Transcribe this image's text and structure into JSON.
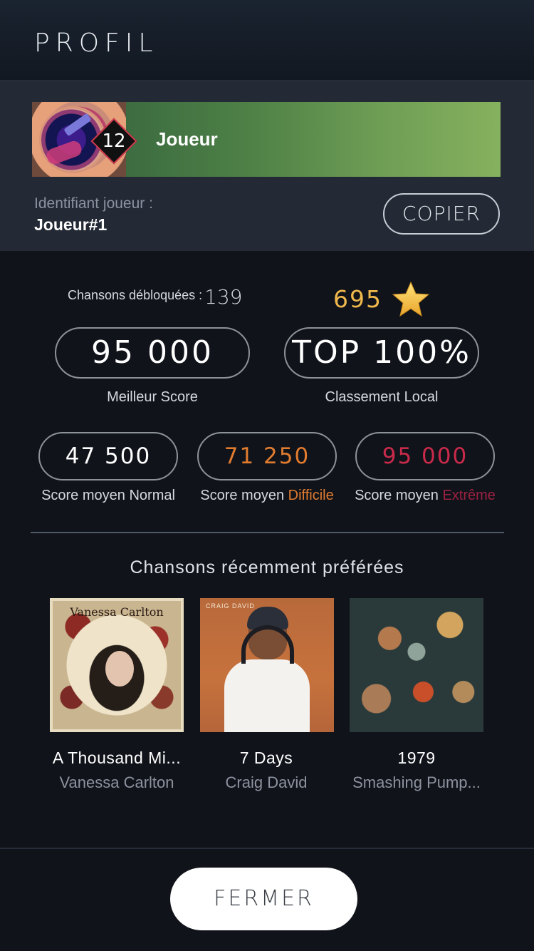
{
  "header": {
    "title": "PROFIL"
  },
  "player": {
    "name": "Joueur",
    "level": "12",
    "id_label": "Identifiant joueur :",
    "id_value": "Joueur#1",
    "copy_label": "COPIER"
  },
  "stats": {
    "unlocked_label": "Chansons débloquées :",
    "unlocked_value": "139",
    "stars_value": "695",
    "best_score": "95 000",
    "best_score_label": "Meilleur Score",
    "rank": "TOP 100%",
    "rank_label": "Classement Local",
    "avg_prefix": "Score moyen",
    "normal": {
      "value": "47 500",
      "difficulty": "Normal",
      "color": "#ffffff"
    },
    "difficile": {
      "value": "71 250",
      "difficulty": "Difficile",
      "color": "#e07b2f"
    },
    "extreme": {
      "value": "95 000",
      "difficulty": "Extrême",
      "color": "#c92a4a"
    }
  },
  "recent": {
    "title": "Chansons récemment préférées",
    "songs": [
      {
        "title": "A Thousand Mi...",
        "artist": "Vanessa Carlton",
        "cover_text": "Vanessa Carlton"
      },
      {
        "title": "7 Days",
        "artist": "Craig David",
        "cover_text": "CRAIG DAVID"
      },
      {
        "title": "1979",
        "artist": "Smashing Pump..."
      }
    ]
  },
  "footer": {
    "close_label": "FERMER"
  },
  "colors": {
    "accent_gold": "#efb84c",
    "bar_start": "#2f5d3c",
    "bar_end": "#86b15e"
  },
  "icons": {
    "star": "star-icon",
    "level": "level-badge-icon"
  }
}
